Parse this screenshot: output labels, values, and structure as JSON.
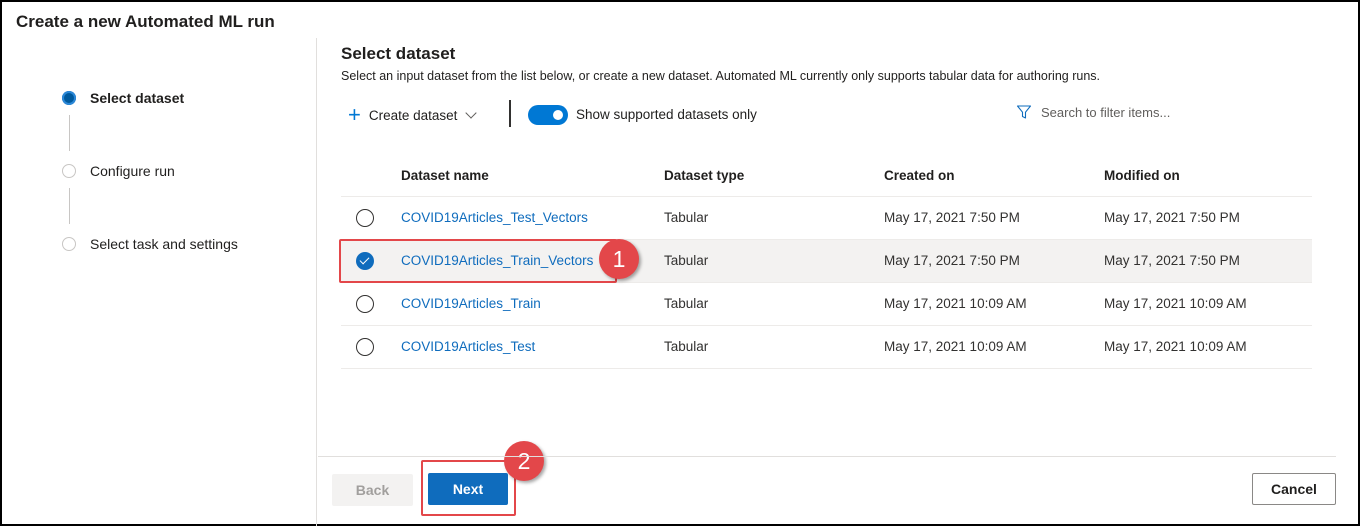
{
  "window": {
    "title": "Create a new Automated ML run"
  },
  "steps": [
    {
      "label": "Select dataset",
      "state": "active"
    },
    {
      "label": "Configure run",
      "state": "pending"
    },
    {
      "label": "Select task and settings",
      "state": "pending"
    }
  ],
  "main": {
    "heading": "Select dataset",
    "subheading": "Select an input dataset from the list below, or create a new dataset. Automated ML currently only supports tabular data for authoring runs."
  },
  "commandbar": {
    "create_label": "Create dataset",
    "toggle_label": "Show supported datasets only",
    "toggle_on": true,
    "filter_placeholder": "Search to filter items..."
  },
  "table": {
    "columns": [
      "Dataset name",
      "Dataset type",
      "Created on",
      "Modified on"
    ],
    "rows": [
      {
        "name": "COVID19Articles_Test_Vectors",
        "type": "Tabular",
        "created": "May 17, 2021 7:50 PM",
        "modified": "May 17, 2021 7:50 PM",
        "selected": false
      },
      {
        "name": "COVID19Articles_Train_Vectors",
        "type": "Tabular",
        "created": "May 17, 2021 7:50 PM",
        "modified": "May 17, 2021 7:50 PM",
        "selected": true
      },
      {
        "name": "COVID19Articles_Train",
        "type": "Tabular",
        "created": "May 17, 2021 10:09 AM",
        "modified": "May 17, 2021 10:09 AM",
        "selected": false
      },
      {
        "name": "COVID19Articles_Test",
        "type": "Tabular",
        "created": "May 17, 2021 10:09 AM",
        "modified": "May 17, 2021 10:09 AM",
        "selected": false
      }
    ]
  },
  "callouts": [
    "1",
    "2"
  ],
  "footer": {
    "back_label": "Back",
    "next_label": "Next",
    "cancel_label": "Cancel"
  },
  "colors": {
    "accent": "#0f6cbd",
    "callout": "#e3474a",
    "link": "#0f6cbd"
  }
}
